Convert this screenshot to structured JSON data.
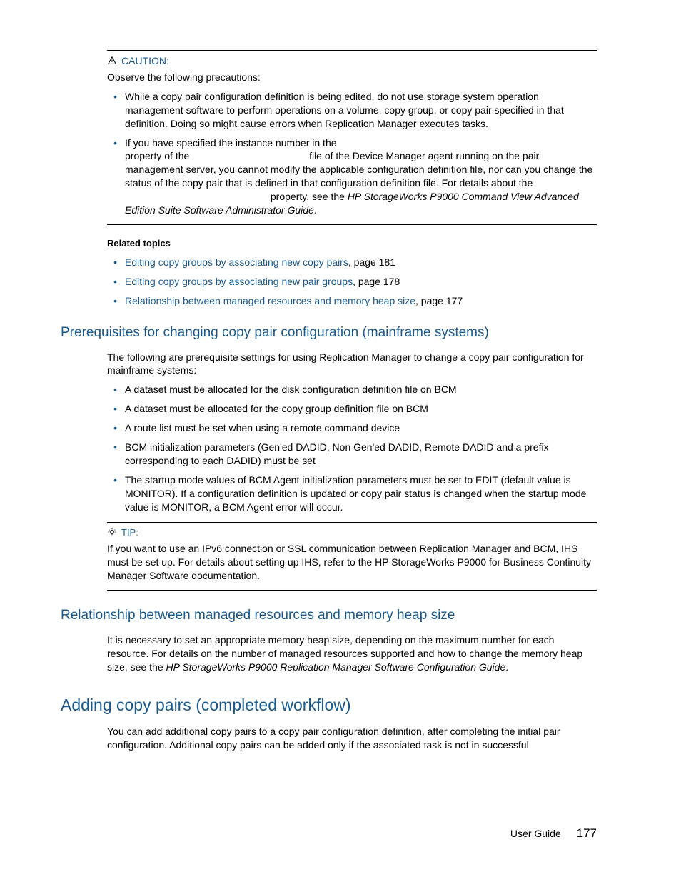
{
  "caution": {
    "label": "CAUTION:",
    "intro": "Observe the following precautions:",
    "bullets": [
      "While a copy pair configuration definition is being edited, do not use storage system operation management software to perform operations on a volume, copy group, or copy pair specified in that definition. Doing so might cause errors when Replication Manager executes tasks."
    ],
    "bullet2_part1": "If you have specified the instance number in the",
    "bullet2_part2": "property of the",
    "bullet2_part3": "file of the Device Manager agent running on the pair management server, you cannot modify the applicable configuration definition file, nor can you change the status of the copy pair that is defined in that configuration definition file. For details about the",
    "bullet2_part4": "property, see the ",
    "bullet2_ref": "HP StorageWorks P9000 Command View Advanced Edition Suite Software Administrator Guide",
    "bullet2_end": "."
  },
  "related": {
    "heading": "Related topics",
    "items": [
      {
        "link": "Editing copy groups by associating new copy pairs",
        "suffix": ", page 181"
      },
      {
        "link": "Editing copy groups by associating new pair groups",
        "suffix": ", page 178"
      },
      {
        "link": "Relationship between managed resources and memory heap size",
        "suffix": ", page 177"
      }
    ]
  },
  "prereq": {
    "heading": "Prerequisites for changing copy pair configuration (mainframe systems)",
    "intro": "The following are prerequisite settings for using Replication Manager to change a copy pair configuration for mainframe systems:",
    "bullets": [
      "A dataset must be allocated for the disk configuration definition file on BCM",
      "A dataset must be allocated for the copy group definition file on BCM",
      "A route list must be set when using a remote command device",
      "BCM initialization parameters (Gen'ed DADID, Non Gen'ed DADID, Remote DADID and a prefix corresponding to each DADID) must be set",
      "The startup mode values of BCM Agent initialization parameters must be set to EDIT (default value is MONITOR). If a configuration definition is updated or copy pair status is changed when the startup mode value is MONITOR, a BCM Agent error will occur."
    ]
  },
  "tip": {
    "label": "TIP:",
    "text": "If you want to use an IPv6 connection or SSL communication between Replication Manager and BCM, IHS must be set up. For details about setting up IHS, refer to the HP StorageWorks P9000 for Business Continuity Manager Software documentation."
  },
  "relationship": {
    "heading": "Relationship between managed resources and memory heap size",
    "text_part1": "It is necessary to set an appropriate memory heap size, depending on the maximum number for each resource. For details on the number of managed resources supported and how to change the memory heap size, see the ",
    "text_ref": "HP StorageWorks P9000 Replication Manager Software Configuration Guide",
    "text_end": "."
  },
  "adding": {
    "heading": "Adding copy pairs (completed workflow)",
    "text": "You can add additional copy pairs to a copy pair configuration definition, after completing the initial pair configuration. Additional copy pairs can be added only if the associated task is not in successful"
  },
  "footer": {
    "label": "User Guide",
    "page": "177"
  }
}
